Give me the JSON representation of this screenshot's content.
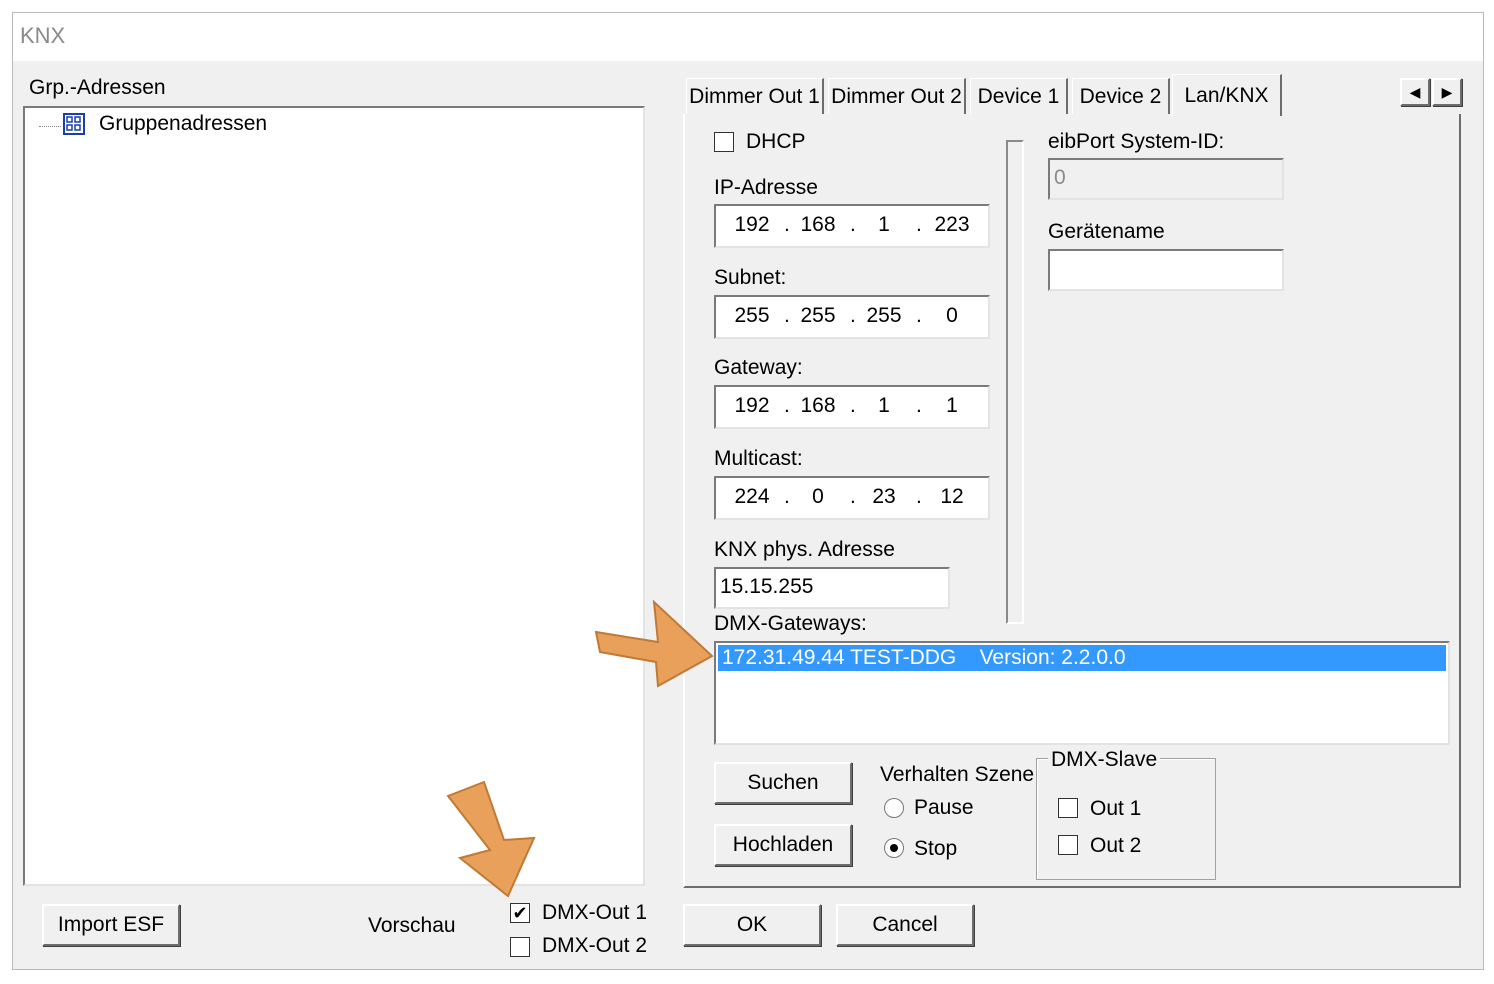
{
  "window": {
    "title": "KNX"
  },
  "left": {
    "label": "Grp.-Adressen",
    "tree_root": "Gruppenadressen"
  },
  "tabs": [
    "Dimmer Out 1",
    "Dimmer Out 2",
    "Device 1",
    "Device 2",
    "Lan/KNX"
  ],
  "lan": {
    "dhcp_label": "DHCP",
    "dhcp_checked": false,
    "ip_label": "IP-Adresse",
    "ip": [
      "192",
      "168",
      "1",
      "223"
    ],
    "subnet_label": "Subnet:",
    "subnet": [
      "255",
      "255",
      "255",
      "0"
    ],
    "gateway_label": "Gateway:",
    "gateway": [
      "192",
      "168",
      "1",
      "1"
    ],
    "multicast_label": "Multicast:",
    "multicast": [
      "224",
      "0",
      "23",
      "12"
    ],
    "knx_label": "KNX phys. Adresse",
    "knx_value": "15.15.255",
    "system_id_label": "eibPort System-ID:",
    "system_id_value": "0",
    "device_name_label": "Gerätename",
    "device_name_value": "",
    "dmx_gateways_label": "DMX-Gateways:",
    "dmx_gateways": [
      "172.31.49.44 TEST-DDG    Version: 2.2.0.0"
    ],
    "search_button": "Suchen",
    "upload_button": "Hochladen",
    "scene_label": "Verhalten Szene",
    "scene_options": [
      "Pause",
      "Stop"
    ],
    "scene_selected": "Stop",
    "slave_label": "DMX-Slave",
    "slave_out1": "Out 1",
    "slave_out2": "Out 2"
  },
  "bottom": {
    "import_button": "Import ESF",
    "preview_label": "Vorschau",
    "dmx_out1": "DMX-Out 1",
    "dmx_out1_checked": true,
    "dmx_out2": "DMX-Out 2",
    "ok_button": "OK",
    "cancel_button": "Cancel"
  },
  "colors": {
    "selection": "#3399ff",
    "arrow": "#e8a05a",
    "arrow_stroke": "#c07a35"
  },
  "icons": {
    "tree_root": "group-address-icon",
    "tab_prev": "arrow-left-icon",
    "tab_next": "arrow-right-icon",
    "annotation": "orange-arrow-icon"
  }
}
